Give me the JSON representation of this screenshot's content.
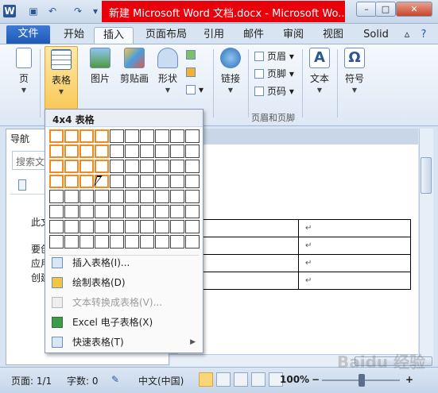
{
  "titlebar": {
    "title": "新建 Microsoft Word 文档.docx - Microsoft Wo...",
    "logo_letter": "W",
    "win_buttons": [
      "–",
      "□",
      "✕"
    ]
  },
  "tabs": [
    "文件",
    "开始",
    "插入",
    "页面布局",
    "引用",
    "邮件",
    "审阅",
    "视图",
    "Solid"
  ],
  "ribbon": {
    "page_label": "页",
    "table_label": "表格",
    "picture_label": "图片",
    "clipart_label": "剪贴画",
    "shapes_label": "形状",
    "link_label": "链接",
    "header_label": "页眉",
    "footer_label": "页脚",
    "page_number_label": "页码",
    "header_footer_group": "页眉和页脚",
    "text_label": "文本",
    "symbol_label": "符号"
  },
  "nav": {
    "title": "导航",
    "search_placeholder": "搜索文",
    "text_lines": [
      "此文",
      "要创",
      "应用",
      "创建"
    ]
  },
  "doc": {
    "table_marks": [
      "↵",
      "↵",
      "↵",
      "↵"
    ]
  },
  "dropdown": {
    "header": "4x4 表格",
    "rows": 8,
    "cols": 10,
    "selected_rows": 4,
    "selected_cols": 4,
    "items": [
      {
        "label": "插入表格(I)...",
        "disabled": false,
        "submenu": false
      },
      {
        "label": "绘制表格(D)",
        "disabled": false,
        "submenu": false
      },
      {
        "label": "文本转换成表格(V)...",
        "disabled": true,
        "submenu": false
      },
      {
        "label": "Excel 电子表格(X)",
        "disabled": false,
        "submenu": false
      },
      {
        "label": "快速表格(T)",
        "disabled": false,
        "submenu": true
      }
    ]
  },
  "status": {
    "page": "页面: 1/1",
    "words": "字数: 0",
    "language": "中文(中国)",
    "zoom": "100%",
    "zoom_minus": "−",
    "zoom_plus": "+"
  },
  "watermark": "Baidu 经验"
}
